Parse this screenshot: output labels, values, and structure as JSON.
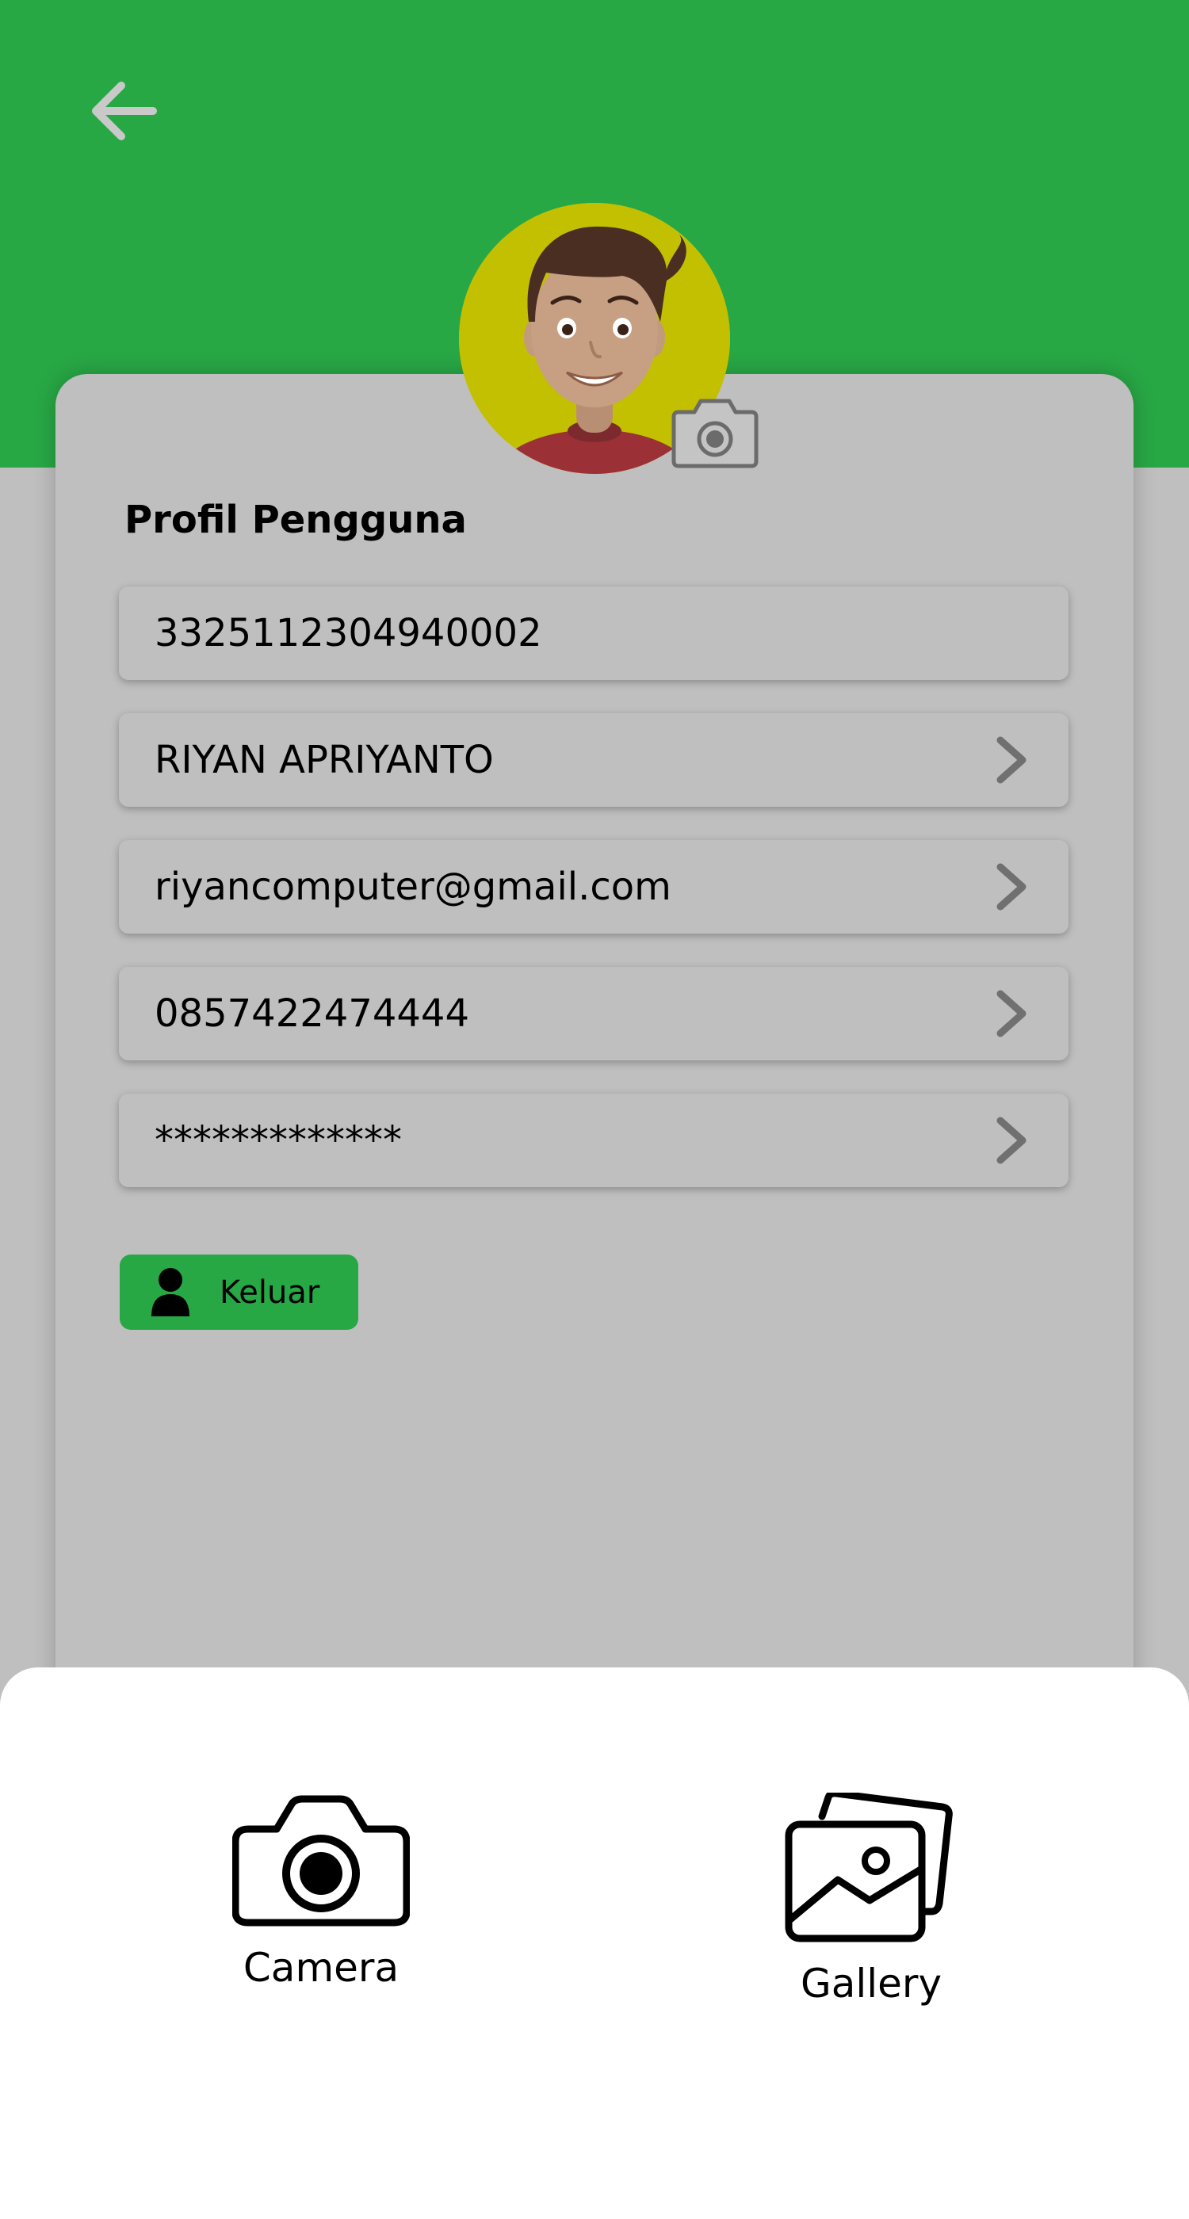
{
  "header": {
    "back_icon": "arrow-left-icon"
  },
  "profile": {
    "avatar_icon": "avatar-illustration",
    "change_photo_icon": "camera-icon",
    "title": "Profil Pengguna",
    "fields": [
      {
        "name": "nik",
        "value": "3325112304940002",
        "has_chevron": false
      },
      {
        "name": "full-name",
        "value": "RIYAN APRIYANTO",
        "has_chevron": true
      },
      {
        "name": "email",
        "value": "riyancomputer@gmail.com",
        "has_chevron": true
      },
      {
        "name": "phone",
        "value": "0857422474444",
        "has_chevron": true
      },
      {
        "name": "password",
        "value": "*************",
        "has_chevron": true
      }
    ],
    "logout_label": "Keluar",
    "logout_icon": "person-icon"
  },
  "bottom_sheet": {
    "options": [
      {
        "label": "Camera",
        "icon": "camera-icon"
      },
      {
        "label": "Gallery",
        "icon": "gallery-icon"
      }
    ]
  },
  "colors": {
    "primary_green": "#28a745",
    "overlay_gray": "#bfbfbf",
    "avatar_bg": "#c2c000",
    "sheet_bg": "#ffffff"
  }
}
